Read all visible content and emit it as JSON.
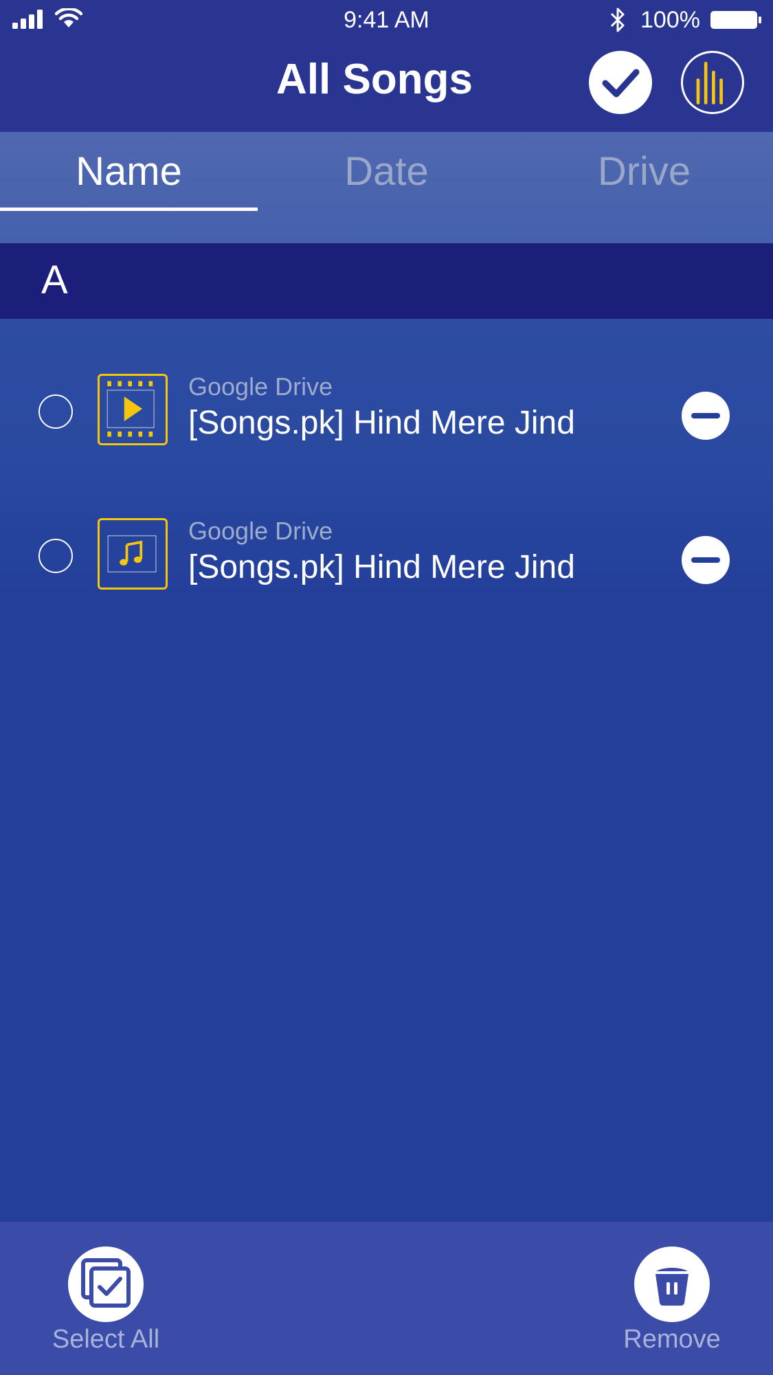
{
  "status_bar": {
    "time": "9:41 AM",
    "battery_percent": "100%",
    "icons": [
      "signal-icon",
      "wifi-icon",
      "bluetooth-icon",
      "battery-icon"
    ]
  },
  "nav": {
    "title": "All Songs",
    "actions": [
      "check-icon",
      "equalizer-icon"
    ]
  },
  "tabs": [
    {
      "label": "Name",
      "active": true
    },
    {
      "label": "Date",
      "active": false
    },
    {
      "label": "Drive",
      "active": false
    }
  ],
  "section": {
    "letter": "A"
  },
  "items": [
    {
      "source": "Google Drive",
      "title": "[Songs.pk] Hind Mere Jind",
      "type_icon": "video-icon"
    },
    {
      "source": "Google Drive",
      "title": "[Songs.pk] Hind Mere Jind",
      "type_icon": "music-note-icon"
    }
  ],
  "bottom_bar": {
    "select_all_label": "Select All",
    "remove_label": "Remove"
  },
  "colors": {
    "accent": "#f5c60b",
    "header": "#2a3591",
    "background": "#233f9a",
    "section": "#1b1f7a",
    "bottom_bar": "#3b4ba8"
  }
}
